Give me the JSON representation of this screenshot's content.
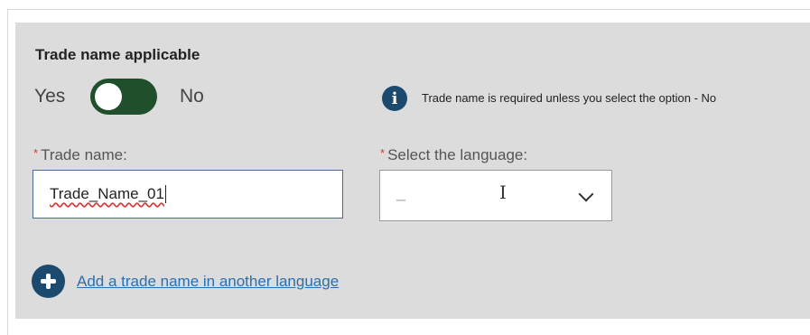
{
  "section": {
    "title": "Trade name applicable"
  },
  "toggle": {
    "yes_label": "Yes",
    "no_label": "No",
    "state": "on",
    "color": "#1f4f2b"
  },
  "info": {
    "icon": "info-icon",
    "text": "Trade name is required unless you select the option - No"
  },
  "trade_name": {
    "required_mark": "*",
    "label": "Trade name:",
    "value": "Trade_Name_01"
  },
  "language": {
    "required_mark": "*",
    "label": "Select the language:",
    "value": "_",
    "icon": "chevron-down-icon"
  },
  "add_link": {
    "icon": "plus-icon",
    "label": "Add a trade name in another language"
  },
  "colors": {
    "panel": "#dcdcdc",
    "accent": "#1c4a6e",
    "link": "#2a6fb0",
    "required": "#d43a3a"
  }
}
